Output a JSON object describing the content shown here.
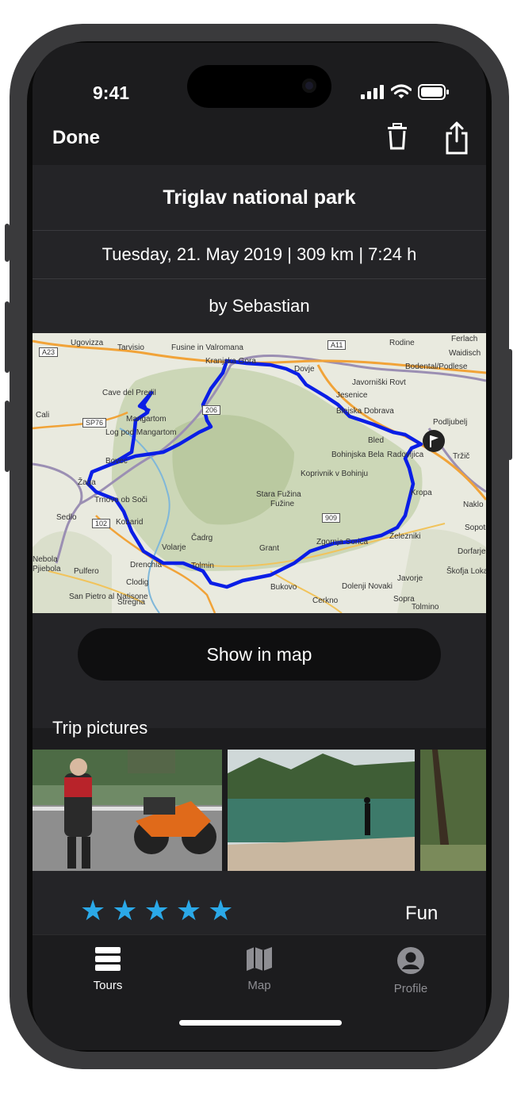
{
  "status": {
    "time": "9:41"
  },
  "nav": {
    "done_label": "Done",
    "delete_icon": "trash-icon",
    "share_icon": "share-icon"
  },
  "trip": {
    "title": "Triglav national park",
    "meta": "Tuesday, 21. May 2019 | 309 km | 7:24 h",
    "author": "by Sebastian"
  },
  "map": {
    "route_color": "#0a1ee6",
    "labels": [
      "Ugovizza",
      "Tarvisio",
      "Fusine in Valromana",
      "Kranjska Gora",
      "Dovje",
      "Rodine",
      "Javorniški Rovt",
      "Jesenice",
      "Bodental/Podlese",
      "Waidisch",
      "Ferlach",
      "Cave del Predil",
      "Cali",
      "Mangartom",
      "Blejska Dobrava",
      "Podljubelj",
      "Bohinjska Bela",
      "Radovljica",
      "Tržič",
      "Bovec",
      "Žaga",
      "Koprivnik v Bohinju",
      "Stara Fužina",
      "Kropa",
      "Trnovo ob Soči",
      "Sedlo",
      "Kobarid",
      "Naklo",
      "Čadrg",
      "Grant",
      "Železniki",
      "Zgornja Sorica",
      "Volarje",
      "Tolmin",
      "Pulfero",
      "Clodig",
      "Drenchia",
      "Bukovo",
      "Dolenji Novaki",
      "Javorje",
      "Škofja Loka",
      "San Pietro al Natisone",
      "Stregna",
      "Cerkno",
      "Sopra",
      "Dorfarje",
      "Tolmino",
      "Nebola",
      "Pjiebola",
      "Sopotnica",
      "Fužine",
      "Bled",
      "Log pod Mangartom"
    ],
    "roads": [
      "A23",
      "A11",
      "SP76",
      "102",
      "909",
      "206"
    ]
  },
  "show_map_label": "Show in map",
  "pictures_label": "Trip pictures",
  "rating": {
    "stars": 5,
    "max": 5,
    "label": "Fun"
  },
  "tabs": [
    {
      "label": "Tours",
      "icon": "list-icon",
      "active": true
    },
    {
      "label": "Map",
      "icon": "map-icon",
      "active": false
    },
    {
      "label": "Profile",
      "icon": "person-icon",
      "active": false
    }
  ],
  "colors": {
    "accent": "#2ba9e8",
    "background": "#1c1c1e",
    "row": "#242427"
  }
}
